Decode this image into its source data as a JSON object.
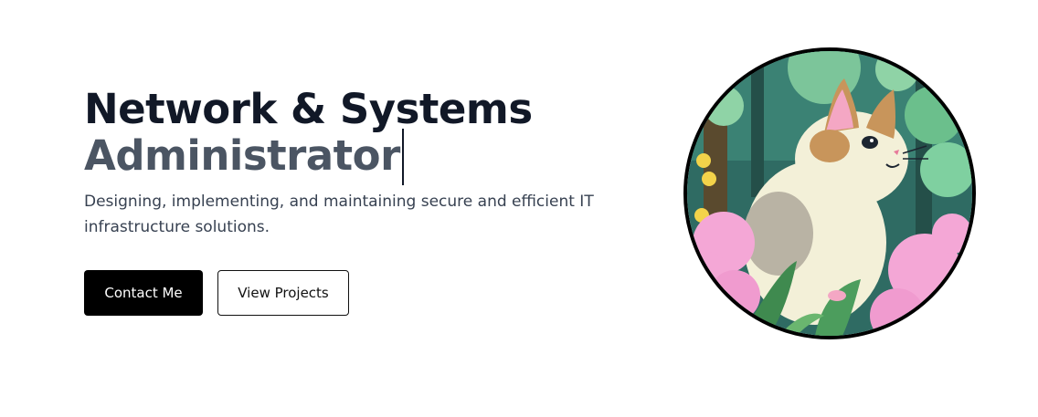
{
  "hero": {
    "title_line_1": "Network & Systems",
    "title_line_2": "Administrator",
    "tagline": "Designing, implementing, and maintaining secure and efficient IT infrastructure solutions.",
    "buttons": {
      "contact_label": "Contact Me",
      "projects_label": "View Projects"
    },
    "avatar": {
      "icon": "cat-illustration",
      "colors": {
        "forest": "#2f6b63",
        "flowers": "#f4a7d6",
        "cat_fur": "#f3f0d8",
        "cat_patch": "#c8955b",
        "border": "#000000"
      }
    }
  }
}
